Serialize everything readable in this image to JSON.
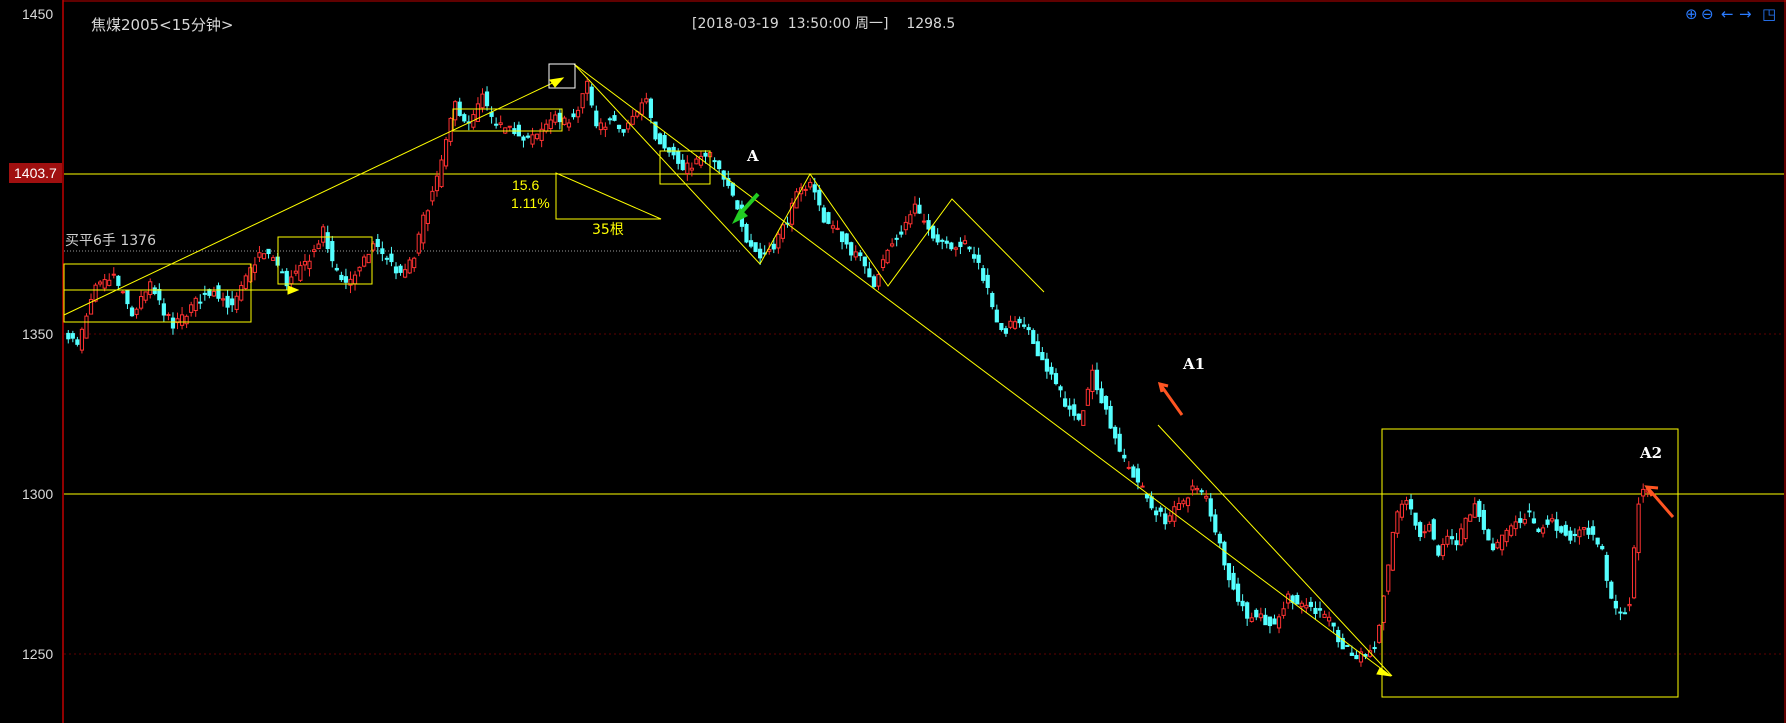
{
  "header": {
    "symbol_label": "焦煤2005<15分钟>",
    "cursor_info": "[2018-03-19  13:50:00 周一]    1298.5"
  },
  "toolbar": {
    "zoom_in_icon": "zoom-in-icon",
    "zoom_out_icon": "zoom-out-icon",
    "scroll_left_icon": "arrow-left-icon",
    "scroll_right_icon": "arrow-right-icon",
    "window_icon": "window-restore-icon"
  },
  "colors": {
    "background": "#000000",
    "up_candle": "#ff3232",
    "down_candle": "#54ffff",
    "annotation": "#ffff00",
    "axis_border": "#c00000",
    "price_tag_bg": "#a01010",
    "green_arrow": "#22cc22",
    "red_arrow": "#ff5522"
  },
  "chart_data": {
    "type": "candlestick",
    "timeframe": "15分钟",
    "ylim": [
      1240,
      1450
    ],
    "yticks": [
      "1450",
      "1350",
      "1300",
      "1250"
    ],
    "highlight_price": "1403.7",
    "horizontal_levels": [
      1403.7,
      1300
    ],
    "annotations": {
      "position_label": "买平6手 1376",
      "position_price": 1376,
      "measure_value": "15.6",
      "measure_percent": "1.11%",
      "measure_bars": "35根",
      "label_a": "A",
      "label_a1": "A1",
      "label_a2": "A2"
    },
    "price_path": [
      [
        0,
        1350
      ],
      [
        2,
        1346
      ],
      [
        6,
        1364
      ],
      [
        10,
        1368
      ],
      [
        14,
        1356
      ],
      [
        18,
        1365
      ],
      [
        23,
        1352
      ],
      [
        28,
        1360
      ],
      [
        32,
        1364
      ],
      [
        36,
        1358
      ],
      [
        40,
        1370
      ],
      [
        42,
        1375
      ],
      [
        45,
        1374
      ],
      [
        48,
        1366
      ],
      [
        51,
        1370
      ],
      [
        54,
        1376
      ],
      [
        56,
        1382
      ],
      [
        58,
        1372
      ],
      [
        61,
        1366
      ],
      [
        64,
        1370
      ],
      [
        67,
        1378
      ],
      [
        70,
        1374
      ],
      [
        73,
        1368
      ],
      [
        76,
        1374
      ],
      [
        78,
        1386
      ],
      [
        81,
        1398
      ],
      [
        83,
        1410
      ],
      [
        85,
        1422
      ],
      [
        88,
        1415
      ],
      [
        91,
        1424
      ],
      [
        94,
        1414
      ],
      [
        97,
        1416
      ],
      [
        100,
        1410
      ],
      [
        103,
        1412
      ],
      [
        106,
        1418
      ],
      [
        109,
        1416
      ],
      [
        112,
        1420
      ],
      [
        114,
        1428
      ],
      [
        116,
        1414
      ],
      [
        119,
        1417
      ],
      [
        122,
        1413
      ],
      [
        125,
        1420
      ],
      [
        127,
        1424
      ],
      [
        129,
        1412
      ],
      [
        132,
        1408
      ],
      [
        135,
        1401
      ],
      [
        138,
        1404
      ],
      [
        141,
        1406
      ],
      [
        144,
        1398
      ],
      [
        147,
        1390
      ],
      [
        149,
        1380
      ],
      [
        152,
        1374
      ],
      [
        155,
        1378
      ],
      [
        158,
        1386
      ],
      [
        160,
        1393
      ],
      [
        163,
        1398
      ],
      [
        166,
        1386
      ],
      [
        169,
        1382
      ],
      [
        172,
        1376
      ],
      [
        175,
        1372
      ],
      [
        177,
        1366
      ],
      [
        180,
        1376
      ],
      [
        183,
        1382
      ],
      [
        186,
        1390
      ],
      [
        188,
        1384
      ],
      [
        191,
        1380
      ],
      [
        194,
        1378
      ],
      [
        197,
        1378
      ],
      [
        200,
        1372
      ],
      [
        202,
        1364
      ],
      [
        205,
        1350
      ],
      [
        208,
        1354
      ],
      [
        211,
        1350
      ],
      [
        214,
        1342
      ],
      [
        217,
        1334
      ],
      [
        220,
        1326
      ],
      [
        222,
        1322
      ],
      [
        225,
        1338
      ],
      [
        227,
        1330
      ],
      [
        229,
        1322
      ],
      [
        232,
        1310
      ],
      [
        235,
        1304
      ],
      [
        238,
        1296
      ],
      [
        241,
        1292
      ],
      [
        244,
        1296
      ],
      [
        247,
        1302
      ],
      [
        250,
        1299
      ],
      [
        253,
        1284
      ],
      [
        256,
        1270
      ],
      [
        259,
        1262
      ],
      [
        262,
        1262
      ],
      [
        265,
        1258
      ],
      [
        268,
        1268
      ],
      [
        271,
        1266
      ],
      [
        274,
        1264
      ],
      [
        277,
        1260
      ],
      [
        280,
        1252
      ],
      [
        283,
        1249
      ],
      [
        285,
        1250
      ],
      [
        287,
        1252
      ],
      [
        289,
        1268
      ],
      [
        291,
        1288
      ],
      [
        293,
        1298
      ],
      [
        295,
        1295
      ],
      [
        297,
        1286
      ],
      [
        299,
        1290
      ],
      [
        301,
        1280
      ],
      [
        303,
        1286
      ],
      [
        305,
        1284
      ],
      [
        307,
        1292
      ],
      [
        309,
        1296
      ],
      [
        311,
        1290
      ],
      [
        313,
        1282
      ],
      [
        315,
        1286
      ],
      [
        317,
        1290
      ],
      [
        319,
        1292
      ],
      [
        321,
        1294
      ],
      [
        323,
        1288
      ],
      [
        325,
        1292
      ],
      [
        327,
        1290
      ],
      [
        329,
        1288
      ],
      [
        331,
        1286
      ],
      [
        333,
        1290
      ],
      [
        335,
        1287
      ],
      [
        337,
        1282
      ],
      [
        339,
        1266
      ],
      [
        341,
        1262
      ],
      [
        343,
        1266
      ],
      [
        345,
        1298
      ],
      [
        347,
        1302
      ]
    ]
  }
}
